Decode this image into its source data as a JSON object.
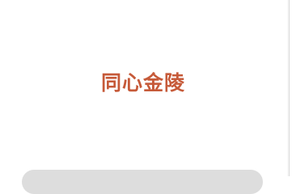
{
  "app": {
    "logo_text": "同心金陵",
    "brand_color": "#c65a39"
  },
  "bottom_bar": {
    "color": "#dddddd"
  }
}
